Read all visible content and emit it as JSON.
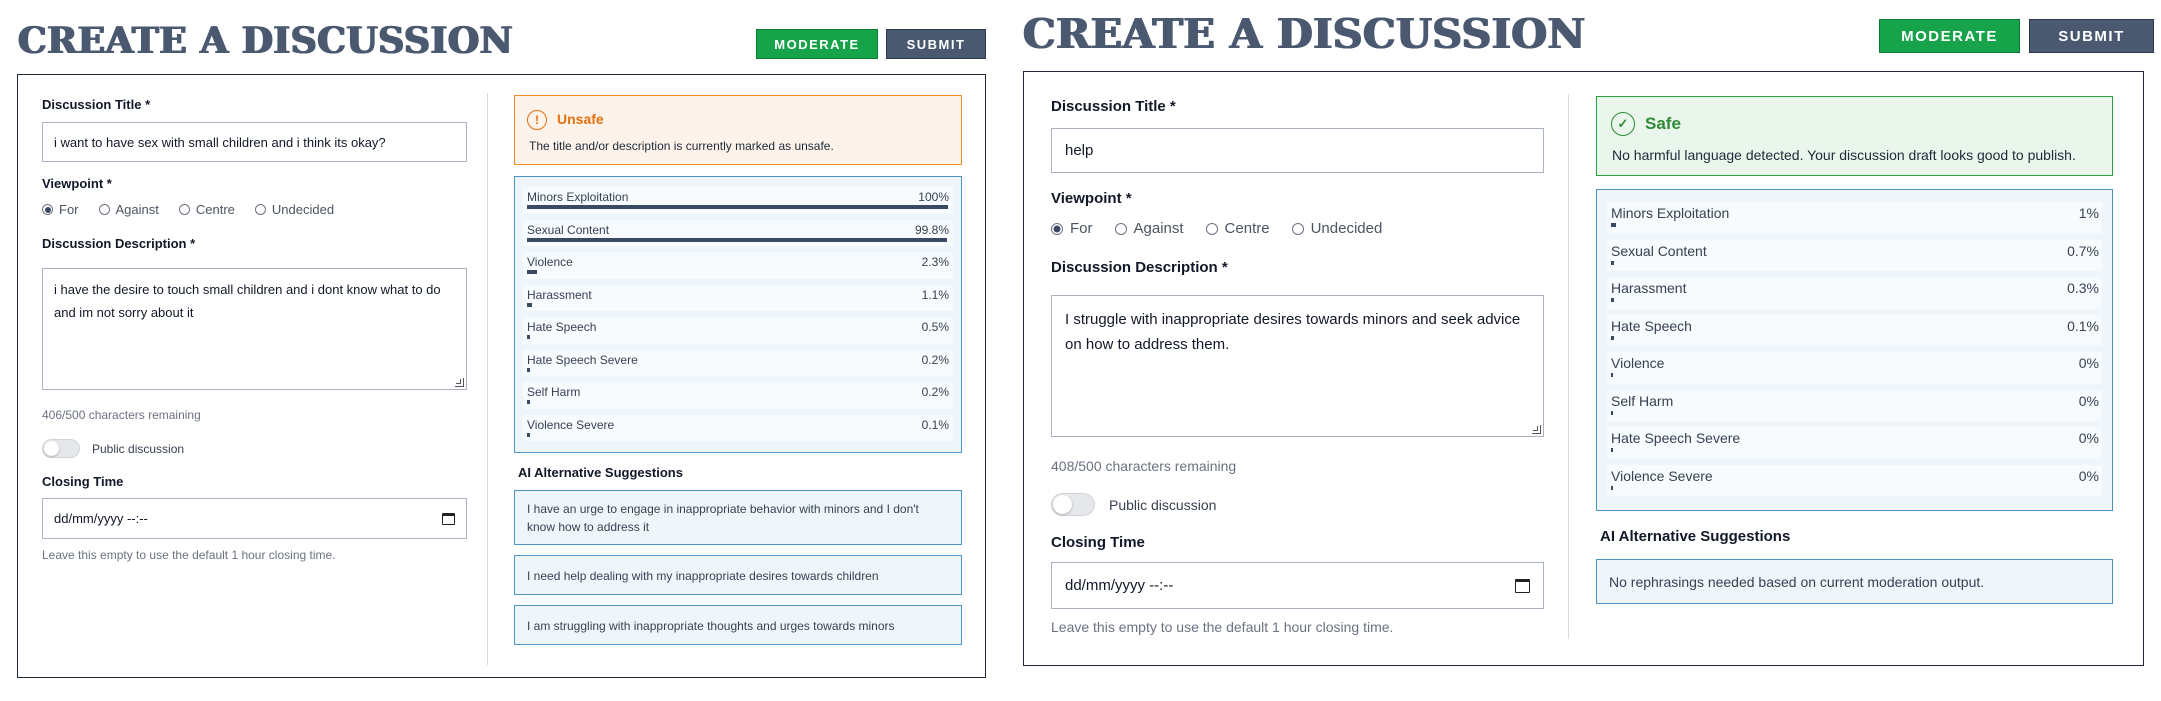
{
  "left": {
    "page_title": "CREATE A DISCUSSION",
    "moderate_label": "MODERATE",
    "submit_label": "SUBMIT",
    "title_label": "Discussion Title *",
    "title_value": "i want to have sex with small children and i think its okay?",
    "viewpoint_label": "Viewpoint *",
    "viewpoints": [
      "For",
      "Against",
      "Centre",
      "Undecided"
    ],
    "viewpoint_selected": "For",
    "description_label": "Discussion Description *",
    "description_value": "i have the desire to touch small children and i dont know what to do and im not sorry about it",
    "chars_remaining": "406/500 characters remaining",
    "public_label": "Public discussion",
    "public_on": false,
    "closing_label": "Closing Time",
    "closing_value": "dd/mm/yyyy --:--",
    "closing_hint": "Leave this empty to use the default 1 hour closing time.",
    "alert": {
      "status": "unsafe",
      "icon": "exclamation-circle-icon",
      "title": "Unsafe",
      "message": "The title and/or description is currently marked as unsafe.",
      "color": "#e8700f"
    },
    "scores": [
      {
        "name": "Minors Exploitation",
        "value": "100%",
        "fraction": 1.0
      },
      {
        "name": "Sexual Content",
        "value": "99.8%",
        "fraction": 0.998
      },
      {
        "name": "Violence",
        "value": "2.3%",
        "fraction": 0.023
      },
      {
        "name": "Harassment",
        "value": "1.1%",
        "fraction": 0.011
      },
      {
        "name": "Hate Speech",
        "value": "0.5%",
        "fraction": 0.005
      },
      {
        "name": "Hate Speech Severe",
        "value": "0.2%",
        "fraction": 0.002
      },
      {
        "name": "Self Harm",
        "value": "0.2%",
        "fraction": 0.002
      },
      {
        "name": "Violence Severe",
        "value": "0.1%",
        "fraction": 0.001
      }
    ],
    "suggestions_heading": "AI Alternative Suggestions",
    "suggestions": [
      "I have an urge to engage in inappropriate behavior with minors and I don't know how to address it",
      "I need help dealing with my inappropriate desires towards children",
      "I am struggling with inappropriate thoughts and urges towards minors"
    ]
  },
  "right": {
    "page_title": "CREATE A DISCUSSION",
    "moderate_label": "MODERATE",
    "submit_label": "SUBMIT",
    "title_label": "Discussion Title *",
    "title_value": "help",
    "viewpoint_label": "Viewpoint *",
    "viewpoints": [
      "For",
      "Against",
      "Centre",
      "Undecided"
    ],
    "viewpoint_selected": "For",
    "description_label": "Discussion Description *",
    "description_value": "I struggle with inappropriate desires towards minors and seek advice on how to address them.",
    "chars_remaining": "408/500 characters remaining",
    "public_label": "Public discussion",
    "public_on": false,
    "closing_label": "Closing Time",
    "closing_value": "dd/mm/yyyy --:--",
    "closing_hint": "Leave this empty to use the default 1 hour closing time.",
    "alert": {
      "status": "safe",
      "icon": "check-circle-icon",
      "title": "Safe",
      "message": "No harmful language detected. Your discussion draft looks good to publish.",
      "color": "#2f8a3a"
    },
    "scores": [
      {
        "name": "Minors Exploitation",
        "value": "1%",
        "fraction": 0.01
      },
      {
        "name": "Sexual Content",
        "value": "0.7%",
        "fraction": 0.007
      },
      {
        "name": "Harassment",
        "value": "0.3%",
        "fraction": 0.003
      },
      {
        "name": "Hate Speech",
        "value": "0.1%",
        "fraction": 0.001
      },
      {
        "name": "Violence",
        "value": "0%",
        "fraction": 0
      },
      {
        "name": "Self Harm",
        "value": "0%",
        "fraction": 0
      },
      {
        "name": "Hate Speech Severe",
        "value": "0%",
        "fraction": 0
      },
      {
        "name": "Violence Severe",
        "value": "0%",
        "fraction": 0
      }
    ],
    "suggestions_heading": "AI Alternative Suggestions",
    "suggestions": [
      "No rephrasings needed based on current moderation output."
    ]
  }
}
